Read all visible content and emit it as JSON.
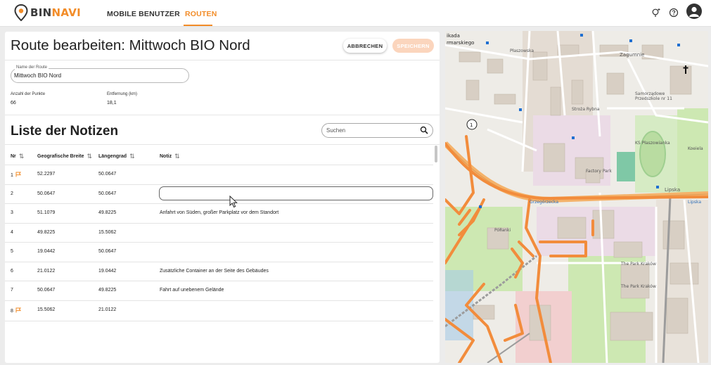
{
  "app": {
    "logo_part1": "BIN",
    "logo_part2": "NAVI",
    "nav": [
      {
        "label": "MOBILE BENUTZER"
      },
      {
        "label": "ROUTEN"
      }
    ],
    "icons": [
      "bulb-icon",
      "help-icon",
      "account-icon"
    ]
  },
  "editor": {
    "title": "Route bearbeiten: Mittwoch BIO Nord",
    "cancel_label": "ABBRECHEN",
    "save_label": "SPEICHERN",
    "name_field_label": "Name der Route",
    "name_field_value": "Mittwoch BIO Nord",
    "points_label": "Anzahl der Punkte",
    "points_value": "66",
    "distance_label": "Entfernung (km)",
    "distance_value": "18,1"
  },
  "notes": {
    "title": "Liste der Notizen",
    "search_placeholder": "Suchen",
    "headers": [
      "Nr",
      "Geografische Breite",
      "Längengrad",
      "Notiz"
    ],
    "rows": [
      {
        "nr": "1",
        "flag": true,
        "lat": "52.2297",
        "lng": "50.0647",
        "note": ""
      },
      {
        "nr": "2",
        "flag": false,
        "lat": "50.0647",
        "lng": "50.0647",
        "note": "",
        "editing": true
      },
      {
        "nr": "3",
        "flag": false,
        "lat": "51.1079",
        "lng": "49.8225",
        "note": "Anfahrt von Süden, großer Parkplatz vor dem Standort"
      },
      {
        "nr": "4",
        "flag": false,
        "lat": "49.8225",
        "lng": "15.5062",
        "note": ""
      },
      {
        "nr": "5",
        "flag": false,
        "lat": "19.0442",
        "lng": "50.0647",
        "note": ""
      },
      {
        "nr": "6",
        "flag": false,
        "lat": "21.0122",
        "lng": "19.0442",
        "note": "Zusätzliche Container an der Seite des Gebäudes"
      },
      {
        "nr": "7",
        "flag": false,
        "lat": "50.0647",
        "lng": "49.8225",
        "note": "Fahrt auf unebenem Gelände"
      },
      {
        "nr": "8",
        "flag": true,
        "lat": "15.5062",
        "lng": "21.0122",
        "note": ""
      }
    ]
  },
  "map": {
    "labels": [
      "ikada",
      "rmarskiego",
      "Płaszowska",
      "Zagumnie",
      "Stroża Rybna",
      "Samorządowe Przedszkole nr 11",
      "KS Płaszowianka",
      "Koeiela",
      "Factory Park",
      "Lipska",
      "Lipska",
      "Grzegórzecka",
      "The Park Kraków",
      "The Park Kraków",
      "Półłanki",
      "1"
    ],
    "colors": {
      "route": "#f28c3c",
      "road": "#f4b26a",
      "green": "#cde8b2",
      "building": "#d8cfc4",
      "industrial": "#ebdbe6"
    }
  }
}
